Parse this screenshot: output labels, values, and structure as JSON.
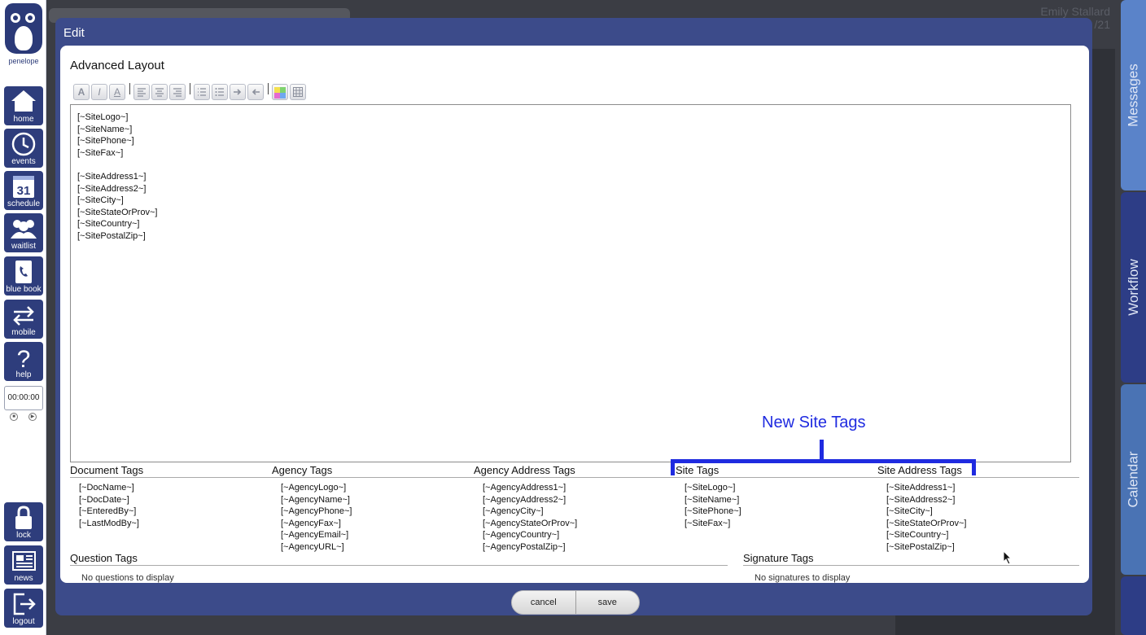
{
  "sidebar": {
    "logo_text": "penelope",
    "items": [
      {
        "label": "home",
        "icon": "home-icon"
      },
      {
        "label": "events",
        "icon": "clock-icon"
      },
      {
        "label": "schedule",
        "icon": "calendar-icon",
        "badge": "31"
      },
      {
        "label": "waitlist",
        "icon": "people-icon"
      },
      {
        "label": "blue book",
        "icon": "phone-book-icon"
      },
      {
        "label": "mobile",
        "icon": "sync-arrows-icon"
      },
      {
        "label": "help",
        "icon": "question-icon"
      },
      {
        "label": "lock",
        "icon": "lock-icon"
      },
      {
        "label": "news",
        "icon": "newspaper-icon"
      },
      {
        "label": "logout",
        "icon": "logout-icon"
      }
    ],
    "timer": "00:00:00"
  },
  "background": {
    "user_name": "Emily Stallard",
    "date_fragment": "/21"
  },
  "right_tabs": [
    {
      "label": "Messages"
    },
    {
      "label": "Workflow"
    },
    {
      "label": "Calendar"
    }
  ],
  "modal": {
    "title": "Edit",
    "section_title": "Advanced Layout",
    "editor_lines": [
      "[~SiteLogo~]",
      "[~SiteName~]",
      "[~SitePhone~]",
      "[~SiteFax~]",
      "",
      "[~SiteAddress1~]",
      "[~SiteAddress2~]",
      "[~SiteCity~]",
      "[~SiteStateOrProv~]",
      "[~SiteCountry~]",
      "[~SitePostalZip~]"
    ],
    "annotation": "New Site Tags",
    "tag_groups": [
      {
        "title": "Document Tags",
        "tags": [
          "[~DocName~]",
          "[~DocDate~]",
          "[~EnteredBy~]",
          "[~LastModBy~]"
        ]
      },
      {
        "title": "Agency Tags",
        "tags": [
          "[~AgencyLogo~]",
          "[~AgencyName~]",
          "[~AgencyPhone~]",
          "[~AgencyFax~]",
          "[~AgencyEmail~]",
          "[~AgencyURL~]"
        ]
      },
      {
        "title": "Agency Address Tags",
        "tags": [
          "[~AgencyAddress1~]",
          "[~AgencyAddress2~]",
          "[~AgencyCity~]",
          "[~AgencyStateOrProv~]",
          "[~AgencyCountry~]",
          "[~AgencyPostalZip~]"
        ]
      },
      {
        "title": "Site Tags",
        "tags": [
          "[~SiteLogo~]",
          "[~SiteName~]",
          "[~SitePhone~]",
          "[~SiteFax~]"
        ]
      },
      {
        "title": "Site Address Tags",
        "tags": [
          "[~SiteAddress1~]",
          "[~SiteAddress2~]",
          "[~SiteCity~]",
          "[~SiteStateOrProv~]",
          "[~SiteCountry~]",
          "[~SitePostalZip~]"
        ]
      }
    ],
    "question_tags": {
      "title": "Question Tags",
      "empty": "No questions to display"
    },
    "signature_tags": {
      "title": "Signature Tags",
      "empty": "No signatures to display"
    },
    "cancel_label": "cancel",
    "save_label": "save"
  },
  "colors": {
    "nav": "#2e3d7c",
    "modal": "#3c4b8a",
    "annotation": "#1f2be0"
  }
}
